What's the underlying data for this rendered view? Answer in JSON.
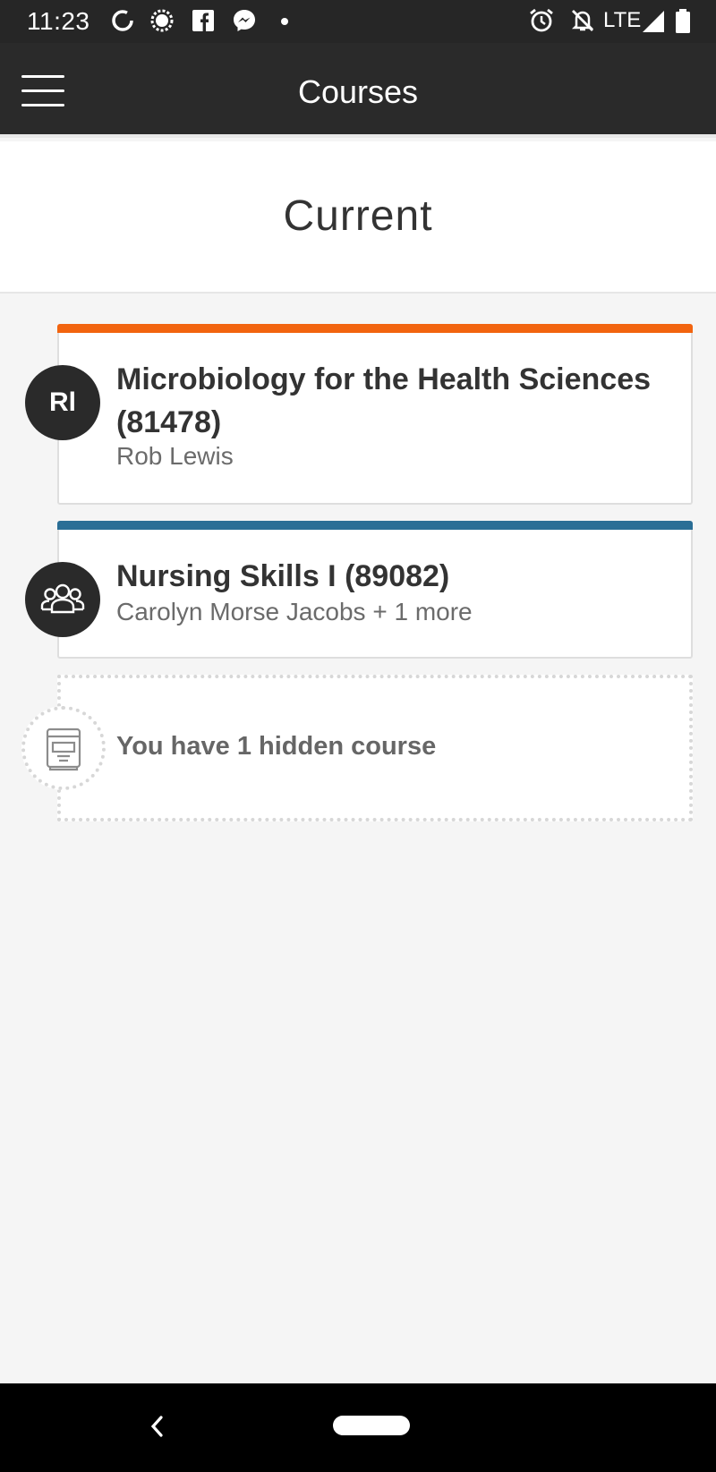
{
  "status_bar": {
    "time": "11:23",
    "network": "LTE",
    "left_icons": [
      "sync-icon",
      "settings-icon",
      "facebook-icon",
      "messenger-icon",
      "notification-dot-icon"
    ],
    "right_icons": [
      "alarm-icon",
      "notifications-off-icon",
      "signal-icon",
      "battery-icon"
    ]
  },
  "app_bar": {
    "title": "Courses",
    "menu_icon": "hamburger-menu-icon"
  },
  "section": {
    "title": "Current"
  },
  "courses": [
    {
      "title": "Microbiology for the Health Sciences (81478)",
      "instructor": "Rob Lewis",
      "avatar_initials": "Rl",
      "accent_color": "#f2640f"
    },
    {
      "title": "Nursing Skills I (89082)",
      "instructor": "Carolyn Morse Jacobs + 1 more",
      "avatar_icon": "group-icon",
      "accent_color": "#2a6e96"
    }
  ],
  "hidden": {
    "text": "You have 1 hidden course",
    "icon": "archive-book-icon"
  },
  "nav_bar": {
    "back_icon": "back-chevron-icon",
    "home_icon": "home-pill-icon"
  }
}
